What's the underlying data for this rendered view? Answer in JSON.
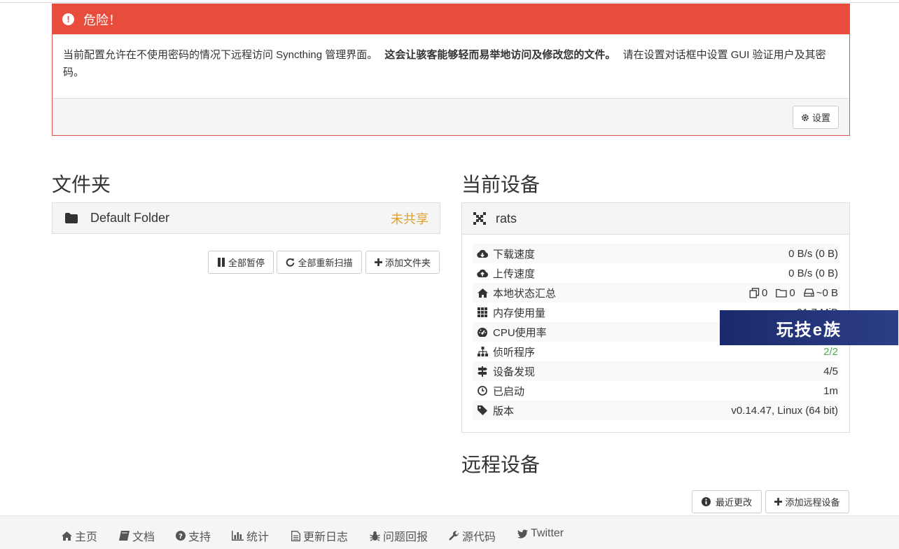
{
  "alert": {
    "title": "危险！",
    "text_before": "当前配置允许在不使用密码的情况下远程访问 Syncthing 管理界面。",
    "text_bold": "这会让骇客能够轻而易举地访问及修改您的文件。",
    "text_after": "请在设置对话框中设置 GUI 验证用户及其密码。",
    "settings_button": "设置"
  },
  "folders": {
    "heading": "文件夹",
    "items": [
      {
        "name": "Default Folder",
        "status": "未共享"
      }
    ],
    "buttons": {
      "pause_all": "全部暂停",
      "rescan_all": "全部重新扫描",
      "add_folder": "添加文件夹"
    }
  },
  "this_device": {
    "heading": "当前设备",
    "name": "rats",
    "stats": [
      {
        "icon": "cloud-download-icon",
        "label": "下载速度",
        "value": "0 B/s (0 B)"
      },
      {
        "icon": "cloud-upload-icon",
        "label": "上传速度",
        "value": "0 B/s (0 B)"
      },
      {
        "icon": "home-icon",
        "label": "本地状态汇总",
        "files": "0",
        "dirs": "0",
        "size": "~0 B"
      },
      {
        "icon": "grid-icon",
        "label": "内存使用量",
        "value": "21.7 MiB"
      },
      {
        "icon": "dashboard-icon",
        "label": "CPU使用率",
        "value": ""
      },
      {
        "icon": "sitemap-icon",
        "label": "侦听程序",
        "value": "2/2"
      },
      {
        "icon": "signpost-icon",
        "label": "设备发现",
        "value": "4/5"
      },
      {
        "icon": "clock-icon",
        "label": "已启动",
        "value": "1m"
      },
      {
        "icon": "tag-icon",
        "label": "版本",
        "value": "v0.14.47, Linux (64 bit)"
      }
    ]
  },
  "remote_devices": {
    "heading": "远程设备",
    "buttons": {
      "recent_changes": "最近更改",
      "add_remote": "添加远程设备"
    }
  },
  "watermark": "玩技e族",
  "footer": {
    "links": [
      "主页",
      "文档",
      "支持",
      "统计",
      "更新日志",
      "问题回报",
      "源代码",
      "Twitter"
    ]
  },
  "colors": {
    "danger": "#e74c3c",
    "unshared": "#e0a030",
    "ok": "#4cae4c"
  }
}
